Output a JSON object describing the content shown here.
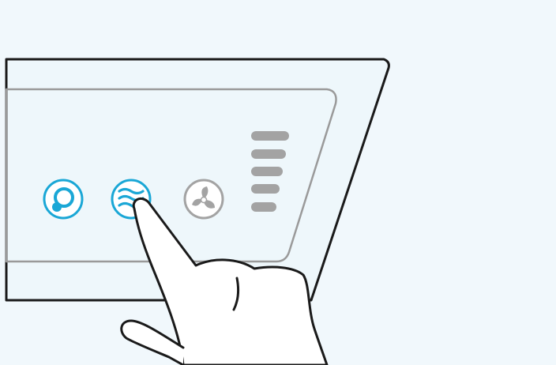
{
  "illustration": {
    "colors": {
      "background": "#f1f8fc",
      "outline": "#1a1a1a",
      "panel": "#eef7fb",
      "inner_border": "#9a9a9a",
      "accent": "#1aa7d6",
      "inactive": "#a3a3a3",
      "hand_fill": "#ffffff"
    },
    "buttons": [
      {
        "name": "circulation-mode-button",
        "icon": "circulation-icon",
        "state": "active"
      },
      {
        "name": "wave-mode-button",
        "icon": "wave-icon",
        "state": "active",
        "pressed": true
      },
      {
        "name": "fan-mode-button",
        "icon": "fan-icon",
        "state": "inactive"
      }
    ],
    "level_indicator": {
      "bars_total": 5,
      "bars_lit": 0
    }
  }
}
